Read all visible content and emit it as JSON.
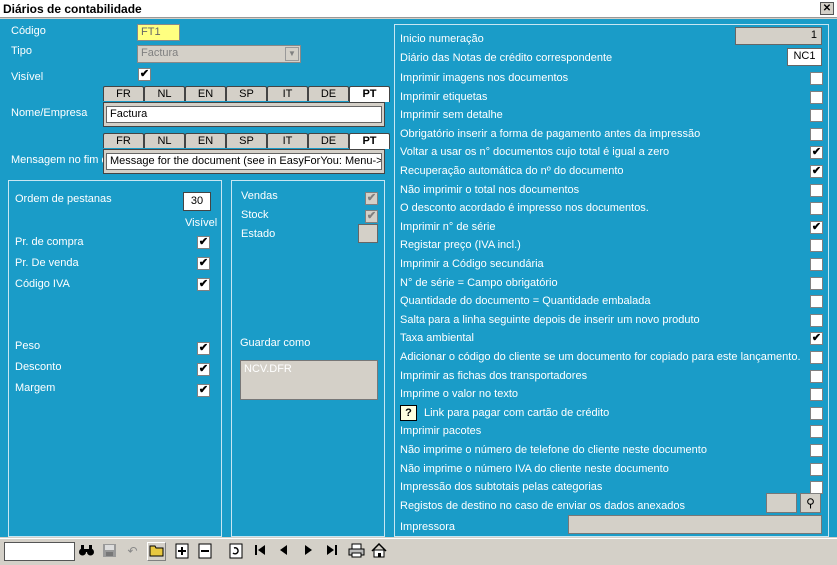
{
  "window": {
    "title": "Diários de contabilidade",
    "close_label": "✕"
  },
  "left": {
    "codigo_label": "Código",
    "codigo_value": "FT1",
    "tipo_label": "Tipo",
    "tipo_value": "Factura",
    "visivel_label": "Visível",
    "nome_label": "Nome/Empresa",
    "nome_value": "Factura",
    "mensagem_label": "Mensagem no fim d",
    "mensagem_value": "Message for the document (see in EasyForYou: Menu->Fi",
    "languages": [
      "FR",
      "NL",
      "EN",
      "SP",
      "IT",
      "DE",
      "PT"
    ]
  },
  "pestanas": {
    "ordem_label": "Ordem de pestanas",
    "ordem_value": "30",
    "visivel_header": "Visível",
    "items": [
      {
        "label": "Pr. de compra",
        "checked": true
      },
      {
        "label": "Pr. De venda",
        "checked": true
      },
      {
        "label": "Código IVA",
        "checked": true
      },
      {
        "label": "Peso",
        "checked": true
      },
      {
        "label": "Desconto",
        "checked": true
      },
      {
        "label": "Margem",
        "checked": true
      }
    ]
  },
  "middle": {
    "vendas_label": "Vendas",
    "stock_label": "Stock",
    "estado_label": "Estado",
    "guardar_label": "Guardar como",
    "guardar_value": "NCV.DFR"
  },
  "right": {
    "inicio_label": "Inicio numeração",
    "inicio_value": "1",
    "diario_nc_label": "Diário das Notas de crédito correspondente",
    "diario_nc_value": "NC1",
    "options": [
      {
        "label": "Imprimir imagens nos documentos",
        "checked": false
      },
      {
        "label": "Imprimir etiquetas",
        "checked": false
      },
      {
        "label": "Imprimir sem detalhe",
        "checked": false
      },
      {
        "label": "Obrigatório inserir a forma de pagamento antes da impressão",
        "checked": false
      },
      {
        "label": "Voltar a usar os n° documentos cujo total é igual a  zero",
        "checked": true
      },
      {
        "label": "Recuperação automática do nº do documento",
        "checked": true
      },
      {
        "label": "Não imprimir o total nos documentos",
        "checked": false
      },
      {
        "label": "O desconto acordado é impresso nos documentos.",
        "checked": false
      },
      {
        "label": "Imprimir n° de série",
        "checked": true
      },
      {
        "label": "Registar preço (IVA incl.)",
        "checked": false
      },
      {
        "label": "Imprimir a Código secundária",
        "checked": false
      },
      {
        "label": "N° de série = Campo obrigatório",
        "checked": false
      },
      {
        "label": "Quantidade do documento = Quantidade embalada",
        "checked": false
      },
      {
        "label": "Salta para a linha seguinte depois de inserir um novo produto",
        "checked": false
      },
      {
        "label": "Taxa ambiental",
        "checked": true
      },
      {
        "label": "Adicionar o código do cliente se um documento for copiado para este lançamento.",
        "checked": false
      },
      {
        "label": "Imprimir as fichas dos transportadores",
        "checked": false
      },
      {
        "label": "Imprime o valor no texto",
        "checked": false
      },
      {
        "label": "Link para pagar com cartão de crédito",
        "checked": false
      },
      {
        "label": "Imprimir pacotes",
        "checked": false
      },
      {
        "label": "Não imprime o número de telefone do cliente neste documento",
        "checked": false
      },
      {
        "label": "Não imprime o número IVA do cliente neste documento",
        "checked": false
      },
      {
        "label": "Impressão dos subtotais pelas categorias",
        "checked": false
      }
    ],
    "registos_label": "Registos de destino no caso de enviar os dados anexados",
    "impressora_label": "Impressora"
  },
  "toolbar": {
    "icons": [
      "binoculars-icon",
      "save-icon",
      "undo-icon",
      "open-folder-icon",
      "add-record-icon",
      "delete-record-icon",
      "refresh-icon",
      "first-record-icon",
      "previous-record-icon",
      "next-record-icon",
      "last-record-icon",
      "print-icon",
      "home-icon"
    ]
  },
  "colors": {
    "panel_bg": "#1a9cc8",
    "code_highlight": "#ffff80"
  }
}
